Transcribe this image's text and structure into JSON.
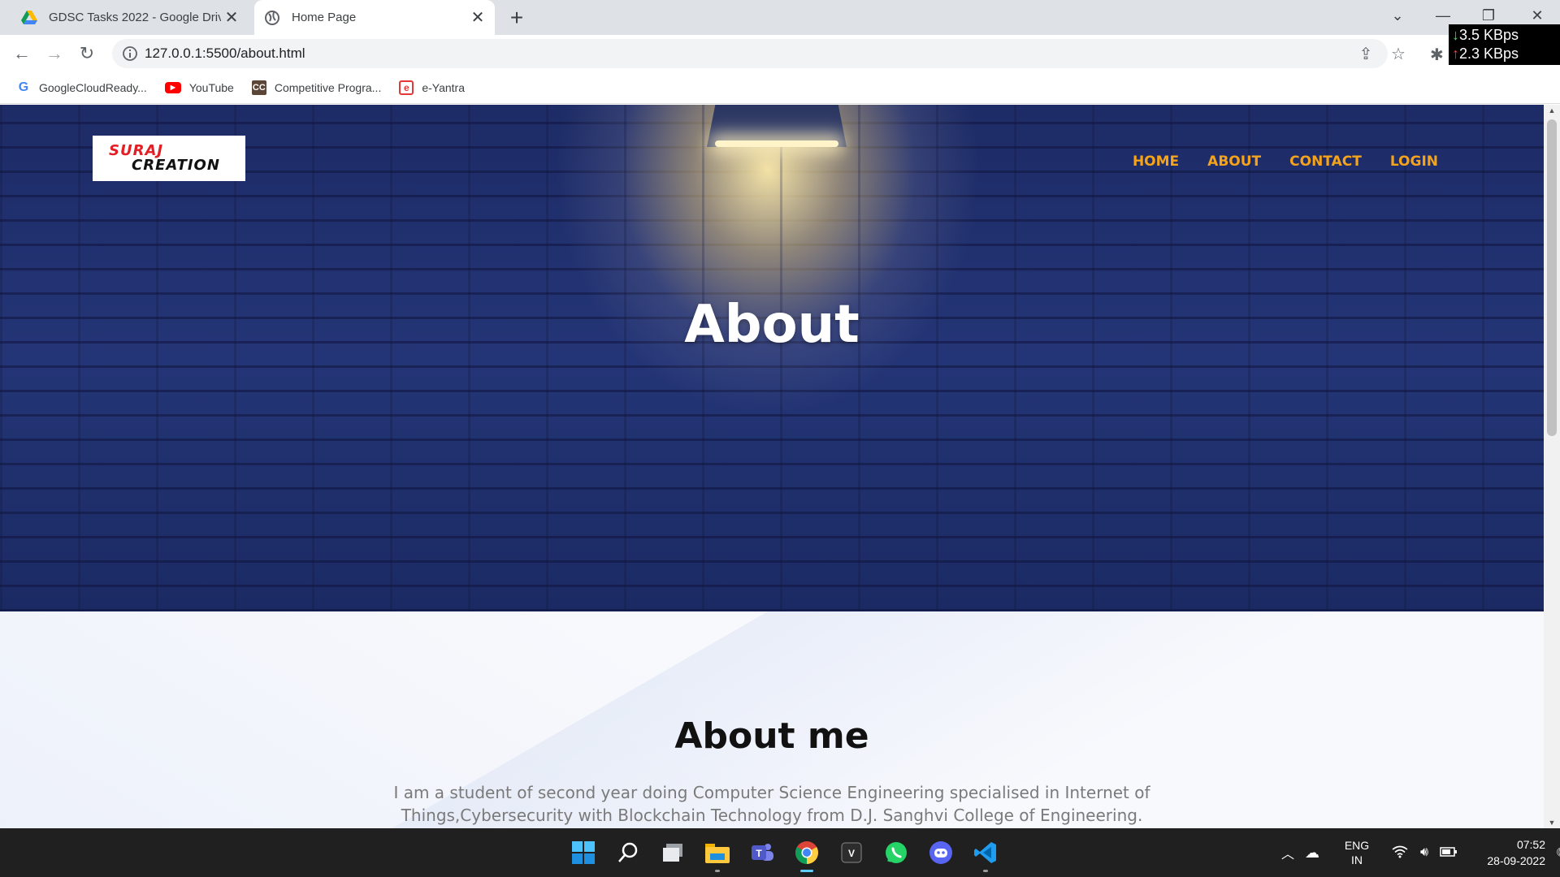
{
  "browser": {
    "tabs": [
      {
        "title": "GDSC Tasks 2022 - Google Drive",
        "active": false
      },
      {
        "title": "Home Page",
        "active": true
      }
    ],
    "new_tab": "+",
    "url": "127.0.0.1:5500/about.html",
    "bookmarks": [
      {
        "label": "GoogleCloudReady...",
        "icon": "google-icon"
      },
      {
        "label": "YouTube",
        "icon": "youtube-icon"
      },
      {
        "label": "Competitive Progra...",
        "icon": "cc-icon"
      },
      {
        "label": "e-Yantra",
        "icon": "eyantra-icon"
      }
    ],
    "netspeed": {
      "down": "3.5 KBps",
      "up": "2.3 KBps"
    }
  },
  "site": {
    "logo_line1": "SURAJ",
    "logo_line2": "CREATION",
    "nav": [
      "HOME",
      "ABOUT",
      "CONTACT",
      "LOGIN"
    ],
    "nav_color": "#f5a31a",
    "hero_title": "About",
    "section_title": "About me",
    "section_text": "I am a student of second year doing Computer Science Engineering specialised in Internet of Things,Cybersecurity with Blockchain Technology from D.J. Sanghvi College of Engineering."
  },
  "taskbar": {
    "apps": [
      "windows-start-icon",
      "search-icon",
      "task-view-icon",
      "file-explorer-icon",
      "teams-icon",
      "chrome-icon",
      "app-icon",
      "whatsapp-icon",
      "discord-icon",
      "vscode-icon"
    ],
    "lang_line1": "ENG",
    "lang_line2": "IN",
    "time": "07:52",
    "date": "28-09-2022"
  }
}
